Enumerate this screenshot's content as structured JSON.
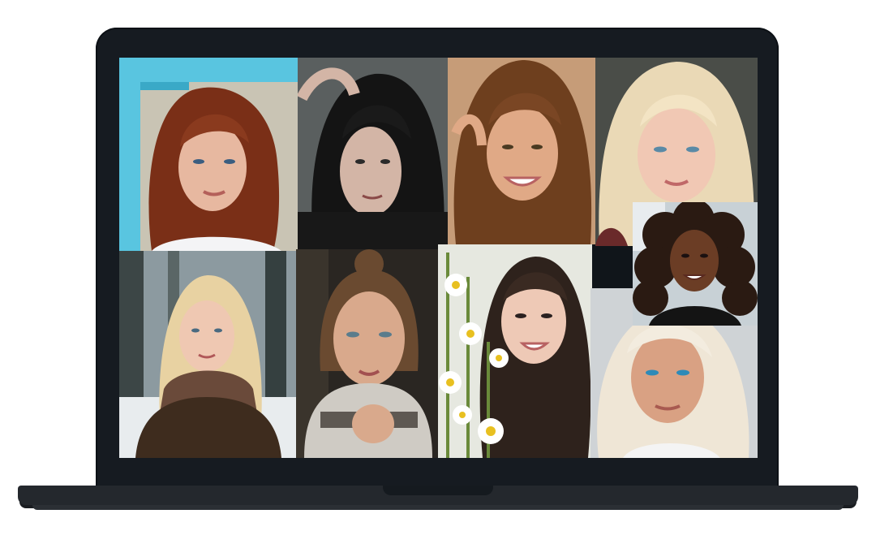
{
  "device": {
    "type": "laptop",
    "frame_color": "#161b21",
    "base_color": "#24282d"
  },
  "collage": {
    "photos": [
      {
        "subject": "portrait-red-hair",
        "bg": "#7fb9c6",
        "hair": "#7a2f17",
        "skin": "#e7b8a0"
      },
      {
        "subject": "portrait-dark-hair-dramatic",
        "bg": "#5a5f5f",
        "hair": "#141414",
        "skin": "#d3b5a6"
      },
      {
        "subject": "portrait-brown-hair-smiling",
        "bg": "#c69c78",
        "hair": "#6e3f1e",
        "skin": "#e0a986"
      },
      {
        "subject": "portrait-platinum-blonde",
        "bg": "#4a4d48",
        "hair": "#ead9b6",
        "skin": "#f1c8b4"
      },
      {
        "subject": "portrait-blonde-scarf-snow",
        "bg": "#8c9aa0",
        "hair": "#e8d2a2",
        "skin": "#efc8b2"
      },
      {
        "subject": "portrait-curly-hair-dark-skin",
        "bg": "#c8d1d6",
        "hair": "#2a1a12",
        "skin": "#6b3d25"
      },
      {
        "subject": "portrait-bun-knit-scarf",
        "bg": "#2a2622",
        "hair": "#6a4a30",
        "skin": "#d9a98c"
      },
      {
        "subject": "portrait-daisies-long-hair",
        "bg": "#e6e8e0",
        "hair": "#2e221c",
        "skin": "#eec9b6"
      },
      {
        "subject": "portrait-short-blonde-blue-eyes",
        "bg": "#cfd3d6",
        "hair": "#efe6d6",
        "skin": "#d9a183"
      }
    ]
  }
}
